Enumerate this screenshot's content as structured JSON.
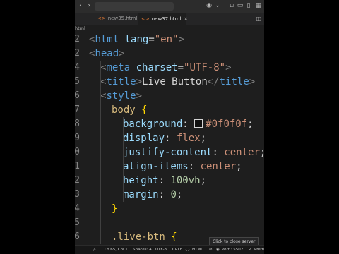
{
  "tabs": [
    {
      "label": "new35.html",
      "active": false
    },
    {
      "label": "new37.html",
      "active": true
    }
  ],
  "breadcrumb": "html",
  "code_lines": [
    {
      "num": "2",
      "kind": "html-open",
      "tag": "html",
      "attr": "lang",
      "value": "\"en\""
    },
    {
      "num": "2",
      "kind": "tag",
      "tag": "head"
    },
    {
      "num": "4",
      "kind": "meta",
      "tag": "meta",
      "attr": "charset",
      "value": "\"UTF-8\""
    },
    {
      "num": "5",
      "kind": "title",
      "tag": "title",
      "text": "Live Button"
    },
    {
      "num": "6",
      "kind": "tag",
      "tag": "style"
    },
    {
      "num": "7",
      "kind": "selector",
      "text": "body"
    },
    {
      "num": "8",
      "kind": "prop",
      "prop": "background",
      "value": "#0f0f0f",
      "swatch": "#0f0f0f"
    },
    {
      "num": "9",
      "kind": "prop",
      "prop": "display",
      "value": "flex"
    },
    {
      "num": "0",
      "kind": "prop",
      "prop": "justify-content",
      "value": "center"
    },
    {
      "num": "1",
      "kind": "prop",
      "prop": "align-items",
      "value": "center"
    },
    {
      "num": "2",
      "kind": "prop",
      "prop": "height",
      "value": "100vh",
      "numeric": true
    },
    {
      "num": "3",
      "kind": "prop",
      "prop": "margin",
      "value": "0",
      "numeric": true
    },
    {
      "num": "4",
      "kind": "close"
    },
    {
      "num": "5",
      "kind": "blank"
    },
    {
      "num": "6",
      "kind": "selector",
      "text": ".live-btn"
    }
  ],
  "tooltip": "Click to close server",
  "status": {
    "position": "Ln 65, Col 1",
    "spaces": "Spaces: 4",
    "encoding": "UTF-8",
    "eol": "CRLF",
    "language": "HTML",
    "port": "Port : 5502",
    "prettier": "Prettier"
  },
  "colors": {
    "editor_bg": "#1e1e1e",
    "tag": "#569cd6",
    "attr": "#9cdcfe",
    "string": "#ce9178",
    "selector": "#d7ba7d",
    "number": "#b5cea8"
  }
}
